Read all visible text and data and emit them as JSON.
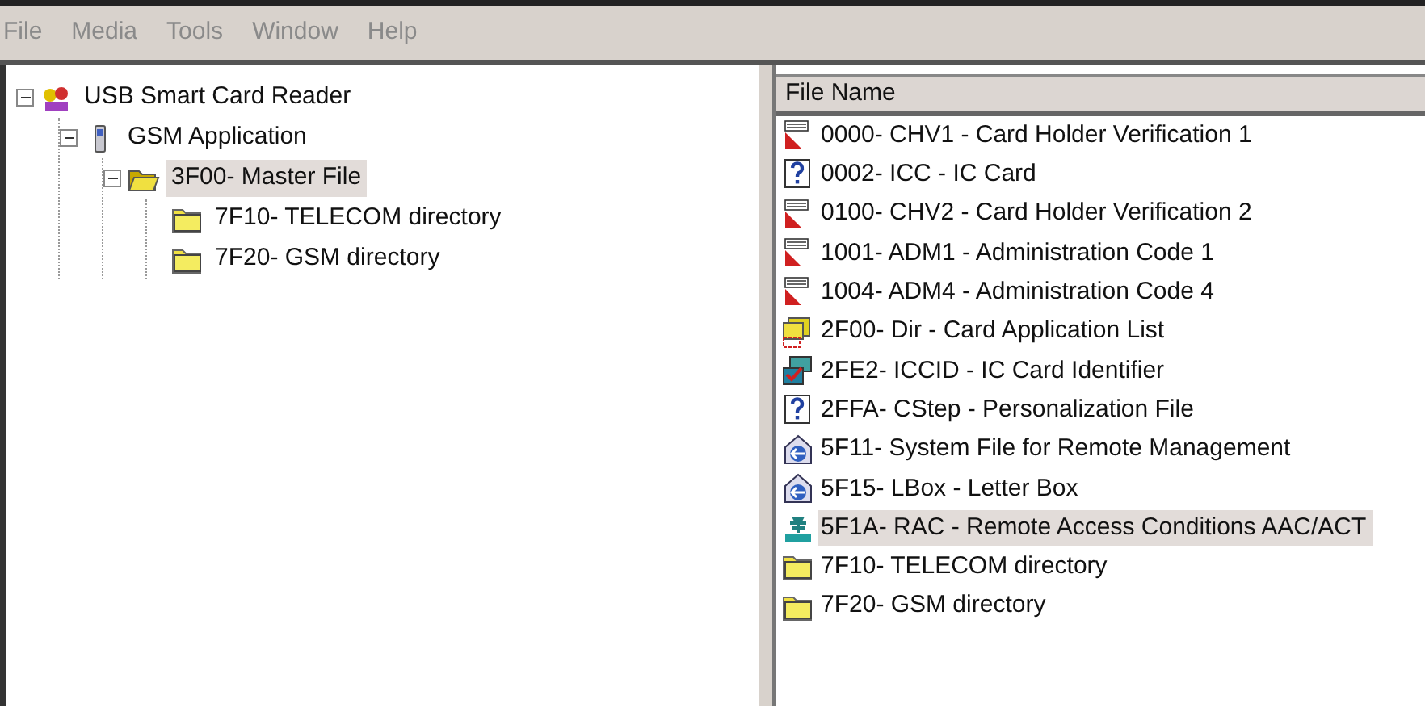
{
  "menu": [
    {
      "label": "File",
      "disabled": true
    },
    {
      "label": "Media",
      "disabled": true
    },
    {
      "label": "Tools",
      "disabled": true
    },
    {
      "label": "Window",
      "disabled": true
    },
    {
      "label": "Help",
      "disabled": true
    }
  ],
  "tree": [
    {
      "label": "USB Smart Card Reader",
      "kind": "reader",
      "expanded": true,
      "selected": false,
      "children": [
        {
          "label": "GSM Application",
          "kind": "phone",
          "expanded": true,
          "selected": false,
          "children": [
            {
              "label": "3F00- Master File",
              "kind": "open-folder",
              "expanded": true,
              "selected": true,
              "children": [
                {
                  "label": "7F10- TELECOM directory",
                  "kind": "folder",
                  "selected": false
                },
                {
                  "label": "7F20- GSM directory",
                  "kind": "folder",
                  "selected": false
                }
              ]
            }
          ]
        }
      ]
    }
  ],
  "file_list": {
    "columns": [
      "File Name"
    ],
    "rows": [
      {
        "name": "0000- CHV1 - Card Holder Verification 1",
        "kind": "code",
        "selected": false
      },
      {
        "name": "0002- ICC - IC Card",
        "kind": "unknown",
        "selected": false
      },
      {
        "name": "0100- CHV2 - Card Holder Verification 2",
        "kind": "code",
        "selected": false
      },
      {
        "name": "1001- ADM1 - Administration Code 1",
        "kind": "code",
        "selected": false
      },
      {
        "name": "1004- ADM4 - Administration Code 4",
        "kind": "code",
        "selected": false
      },
      {
        "name": "2F00- Dir - Card Application List",
        "kind": "app-list",
        "selected": false
      },
      {
        "name": "2FE2- ICCID - IC Card Identifier",
        "kind": "card-id",
        "selected": false
      },
      {
        "name": "2FFA- CStep - Personalization File",
        "kind": "unknown",
        "selected": false
      },
      {
        "name": "5F11- System File for Remote Management",
        "kind": "remote",
        "selected": false
      },
      {
        "name": "5F15- LBox - Letter Box",
        "kind": "remote",
        "selected": false
      },
      {
        "name": "5F1A- RAC - Remote Access Conditions AAC/ACT",
        "kind": "stk",
        "selected": true
      },
      {
        "name": "7F10- TELECOM directory",
        "kind": "folder",
        "selected": false
      },
      {
        "name": "7F20- GSM directory",
        "kind": "folder",
        "selected": false
      }
    ]
  }
}
